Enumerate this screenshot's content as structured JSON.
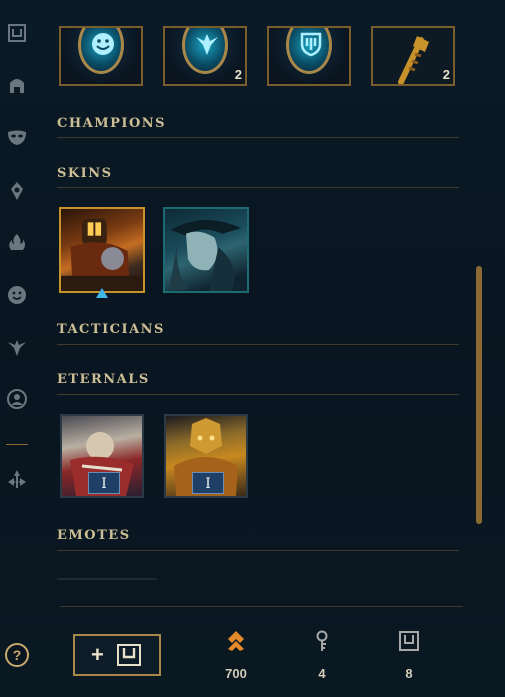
{
  "sidebar": {
    "items": [
      {
        "name": "chest-icon"
      },
      {
        "name": "helmet-icon"
      },
      {
        "name": "mask-icon"
      },
      {
        "name": "ward-icon"
      },
      {
        "name": "flame-icon"
      },
      {
        "name": "emote-icon"
      },
      {
        "name": "tactician-icon"
      },
      {
        "name": "profile-icon"
      },
      {
        "name": "arrows-icon"
      }
    ],
    "help_label": "?"
  },
  "top_tiles": [
    {
      "name": "emote-tile",
      "count": ""
    },
    {
      "name": "ward-tile",
      "count": "2"
    },
    {
      "name": "banner-tile",
      "count": ""
    },
    {
      "name": "key-tile",
      "count": "2"
    }
  ],
  "sections": {
    "champions": "CHAMPIONS",
    "skins": "SKINS",
    "tacticians": "TACTICIANS",
    "eternals": "ETERNALS",
    "emotes": "EMOTES"
  },
  "eternals": [
    {
      "badge": "I"
    },
    {
      "badge": "I"
    }
  ],
  "footer": {
    "add_label": "+",
    "currencies": [
      {
        "name": "orange-essence",
        "value": "700"
      },
      {
        "name": "key",
        "value": "4"
      },
      {
        "name": "chest",
        "value": "8"
      }
    ]
  },
  "colors": {
    "accent_gold": "#c8aa6e",
    "essence_orange": "#e58a2a",
    "divider": "#3f3a2a"
  }
}
